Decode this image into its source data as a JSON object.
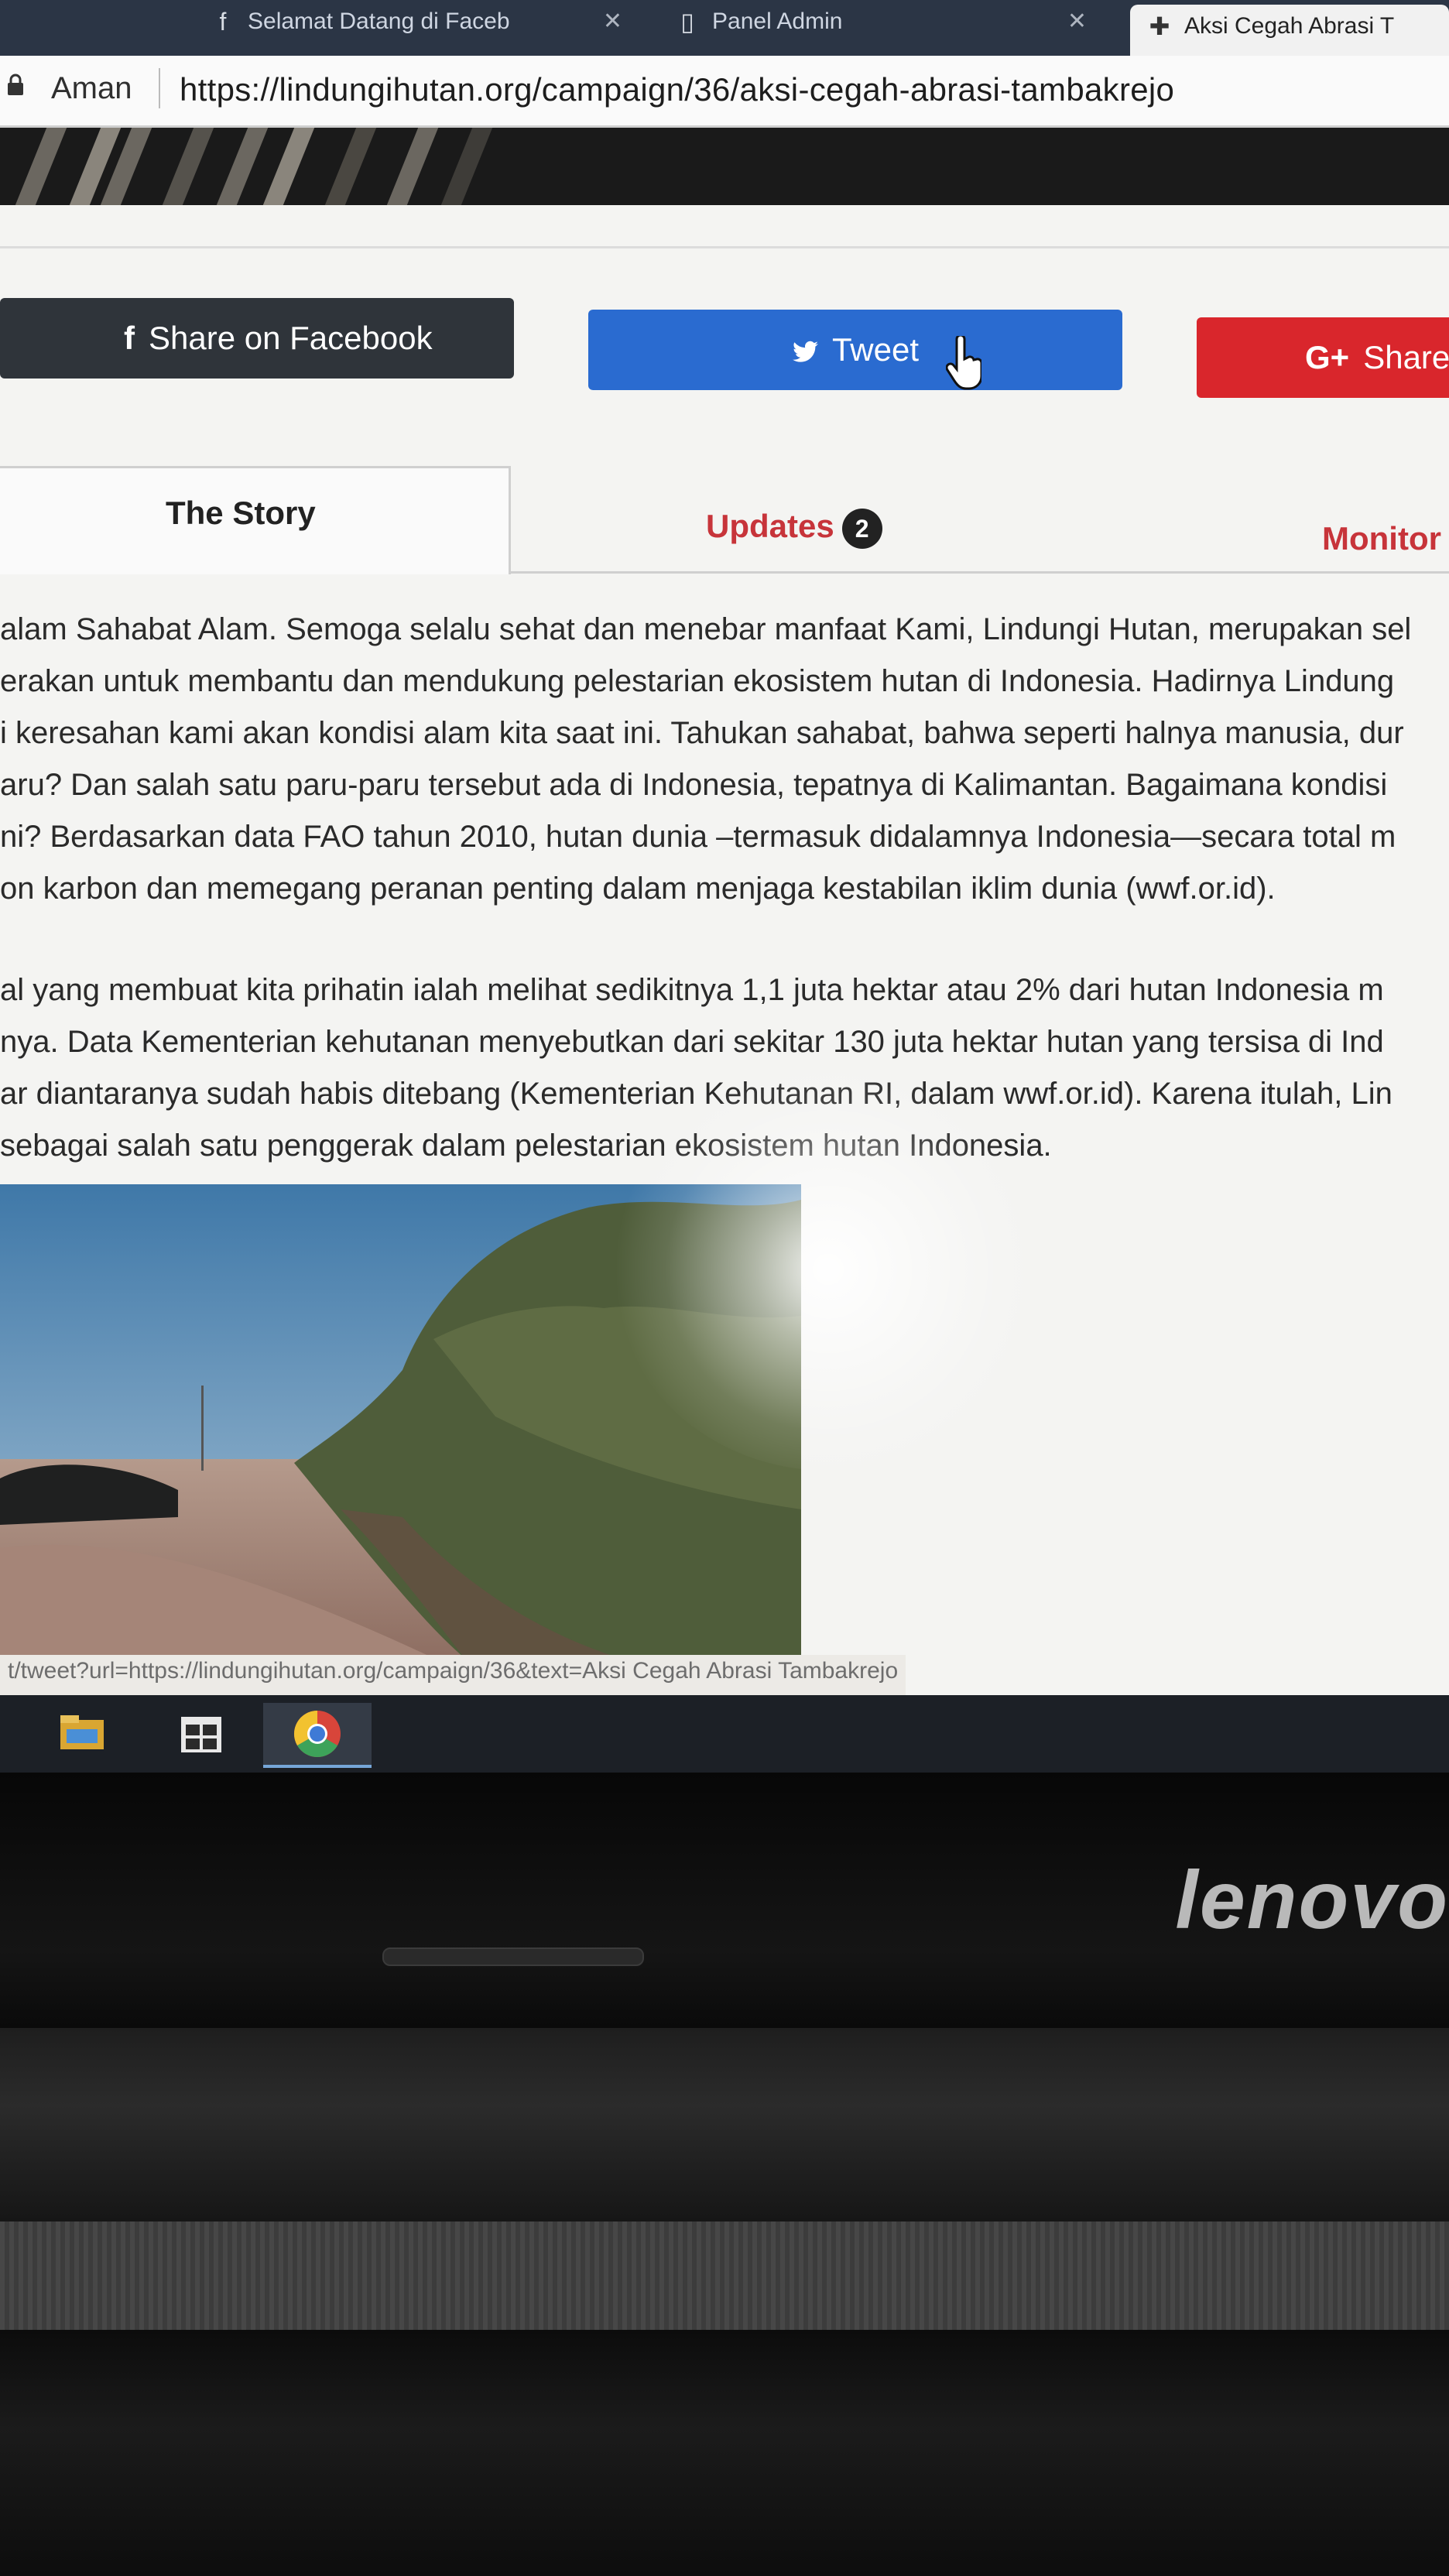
{
  "browser": {
    "tabs": [
      {
        "label": "Selamat Datang di Faceb",
        "icon": "facebook-icon"
      },
      {
        "label": "Panel Admin",
        "icon": "document-icon"
      },
      {
        "label": "Aksi Cegah Abrasi T",
        "icon": "site-favicon-icon"
      }
    ],
    "security_label": "Aman",
    "url": "https://lindungihutan.org/campaign/36/aksi-cegah-abrasi-tambakrejo"
  },
  "share": {
    "facebook": "Share on Facebook",
    "twitter": "Tweet",
    "google": "Share"
  },
  "nav_tabs": {
    "story": "The Story",
    "updates": "Updates",
    "updates_count": "2",
    "monitor": "Monitor"
  },
  "article": {
    "paragraph1": [
      "alam Sahabat Alam. Semoga selalu sehat dan menebar manfaat Kami, Lindungi Hutan, merupakan sel",
      "erakan untuk membantu dan mendukung pelestarian ekosistem hutan di Indonesia. Hadirnya Lindung",
      "i keresahan kami akan kondisi alam kita saat ini. Tahukan sahabat, bahwa seperti halnya manusia, dur",
      "aru? Dan salah satu paru-paru tersebut ada di Indonesia, tepatnya di Kalimantan. Bagaimana kondisi",
      "ni? Berdasarkan data FAO tahun 2010, hutan dunia –termasuk didalamnya Indonesia—secara total m",
      "on karbon dan memegang peranan penting dalam menjaga kestabilan iklim dunia (wwf.or.id)."
    ],
    "paragraph2": [
      "al yang membuat kita prihatin ialah melihat sedikitnya 1,1 juta hektar atau 2% dari hutan Indonesia m",
      "nya. Data Kementerian kehutanan menyebutkan dari sekitar 130 juta hektar hutan yang tersisa di Ind",
      "ar diantaranya sudah habis ditebang (Kementerian Kehutanan RI, dalam wwf.or.id). Karena itulah, Lin",
      "sebagai salah satu penggerak dalam pelestarian ekosistem hutan Indonesia."
    ]
  },
  "status_bar_url": "t/tweet?url=https://lindungihutan.org/campaign/36&text=Aksi Cegah Abrasi Tambakrejo",
  "taskbar": [
    "file-explorer-icon",
    "windows-store-icon",
    "chrome-icon"
  ],
  "device_logo": "lenovo",
  "colors": {
    "facebook": "#2f343a",
    "twitter": "#2a6bd0",
    "google": "#d9262c",
    "accent_red": "#c7343a"
  }
}
